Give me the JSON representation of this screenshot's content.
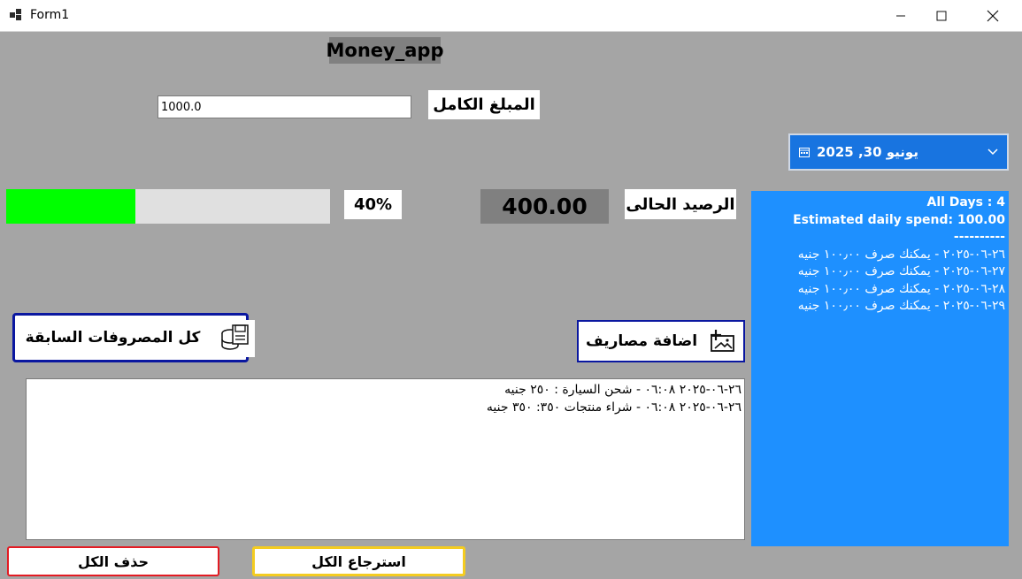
{
  "window": {
    "title": "Form1",
    "minimize": "—",
    "maximize": "☐",
    "close": "✕"
  },
  "header": {
    "title": "Money_app"
  },
  "total_amount": {
    "label": "المبلغ الكامل",
    "value": "1000.0"
  },
  "date_picker": {
    "value": "يونيو 30, 2025"
  },
  "progress": {
    "percent_text": "40%",
    "fraction": 0.4,
    "color": "#00ff00"
  },
  "balance": {
    "value": "400.00",
    "label": "الرصيد الحالى"
  },
  "info_panel": {
    "all_days": "All Days : 4",
    "estimated": "Estimated daily spend: 100.00",
    "separator": "----------",
    "days": [
      "٢٦-٠٦-٢٠٢٥ - يمكنك صرف ١٠٠٫٠٠ جنيه",
      "٢٧-٠٦-٢٠٢٥ - يمكنك صرف ١٠٠٫٠٠ جنيه",
      "٢٨-٠٦-٢٠٢٥ - يمكنك صرف ١٠٠٫٠٠ جنيه",
      "٢٩-٠٦-٢٠٢٥ - يمكنك صرف ١٠٠٫٠٠ جنيه"
    ],
    "background": "#1e90ff"
  },
  "buttons": {
    "previous_expenses": "كل المصروفات السابقة",
    "add_expenses": "اضافة مصاريف",
    "delete_all": "حذف الكل",
    "restore_all": "استرجاع الكل"
  },
  "expenses_list": [
    "٢٦-٠٦-٢٠٢٥ ٠٦:٠٨ - شحن السيارة : ٢٥٠ جنيه",
    "٢٦-٠٦-٢٠٢٥ ٠٦:٠٨ - شراء منتجات ٣٥٠: ٣٥٠ جنيه"
  ],
  "icons": {
    "app": "windows-app-icon",
    "calendar": "calendar-icon",
    "floppy": "floppy-stack-icon",
    "add_image": "add-image-icon"
  }
}
